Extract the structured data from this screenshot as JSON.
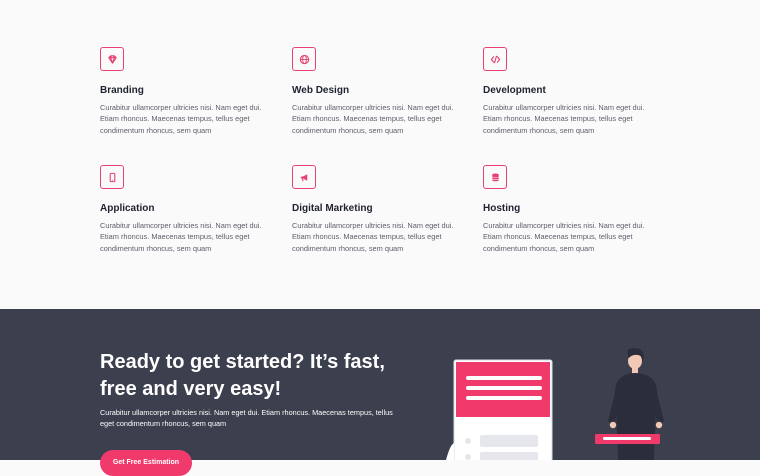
{
  "services": [
    {
      "icon": "gem-icon",
      "title": "Branding",
      "text": "Curabitur ullamcorper ultricies nisi. Nam eget dui. Etiam rhoncus. Maecenas tempus, tellus eget condimentum rhoncus, sem quam"
    },
    {
      "icon": "globe-icon",
      "title": "Web Design",
      "text": "Curabitur ullamcorper ultricies nisi. Nam eget dui. Etiam rhoncus. Maecenas tempus, tellus eget condimentum rhoncus, sem quam"
    },
    {
      "icon": "code-icon",
      "title": "Development",
      "text": "Curabitur ullamcorper ultricies nisi. Nam eget dui. Etiam rhoncus. Maecenas tempus, tellus eget condimentum rhoncus, sem quam"
    },
    {
      "icon": "mobile-icon",
      "title": "Application",
      "text": "Curabitur ullamcorper ultricies nisi. Nam eget dui. Etiam rhoncus. Maecenas tempus, tellus eget condimentum rhoncus, sem quam"
    },
    {
      "icon": "megaphone-icon",
      "title": "Digital Marketing",
      "text": "Curabitur ullamcorper ultricies nisi. Nam eget dui. Etiam rhoncus. Maecenas tempus, tellus eget condimentum rhoncus, sem quam"
    },
    {
      "icon": "database-icon",
      "title": "Hosting",
      "text": "Curabitur ullamcorper ultricies nisi. Nam eget dui. Etiam rhoncus. Maecenas tempus, tellus eget condimentum rhoncus, sem quam"
    }
  ],
  "cta": {
    "title": "Ready to get started? It’s fast, free and very easy!",
    "text": "Curabitur ullamcorper ultricies nisi. Nam eget dui. Etiam rhoncus. Maecenas tempus, tellus eget condimentum rhoncus, sem quam",
    "button_label": "Get Free Estimation",
    "illustration_icon": "person-with-form-illustration"
  },
  "colors": {
    "accent": "#f03a6b",
    "dark_section": "#3c3f4e",
    "light_section": "#fafafb"
  }
}
